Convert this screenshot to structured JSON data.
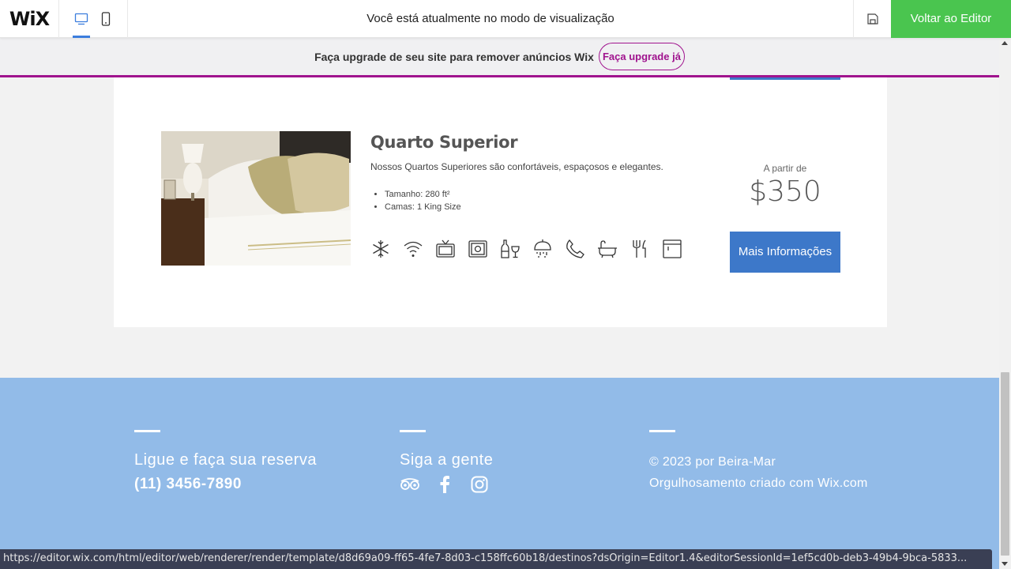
{
  "topbar": {
    "logo": "WiX",
    "mode_text": "Você está atualmente no modo de visualização",
    "back_label": "Voltar ao Editor"
  },
  "banner": {
    "text": "Faça upgrade de seu site para remover anúncios Wix",
    "button_label": "Faça upgrade já"
  },
  "room": {
    "title": "Quarto Superior",
    "description": "Nossos Quartos Superiores são confortáveis, espaçosos e elegantes.",
    "features": [
      "Tamanho: 280 ft²",
      "Camas: 1 King Size"
    ],
    "amenities": [
      "snowflake-icon",
      "wifi-icon",
      "tv-icon",
      "safe-icon",
      "wine-icon",
      "shower-icon",
      "phone-icon",
      "bathtub-icon",
      "utensils-icon",
      "minibar-icon"
    ],
    "price_from": "A partir de",
    "price": "$350",
    "more_label": "Mais Informações"
  },
  "footer": {
    "call_heading": "Ligue e faça sua reserva",
    "phone": "(11) 3456-7890",
    "follow_heading": "Siga a gente",
    "social": [
      "tripadvisor-icon",
      "facebook-icon",
      "instagram-icon"
    ],
    "copyright": "© 2023 por Beira-Mar",
    "credit": "Orgulhosamento criado com Wix.com"
  },
  "status_url": "https://editor.wix.com/html/editor/web/renderer/render/template/d8d69a09-ff65-4fe7-8d03-c158ffc60b18/destinos?dsOrigin=Editor1.4&editorSessionId=1ef5cd0b-deb3-49b4-9bca-5833...",
  "colors": {
    "accent_green": "#4ac54f",
    "upgrade_purple": "#a0138e",
    "button_blue": "#3d78c9",
    "footer_blue": "#92bbe8"
  }
}
